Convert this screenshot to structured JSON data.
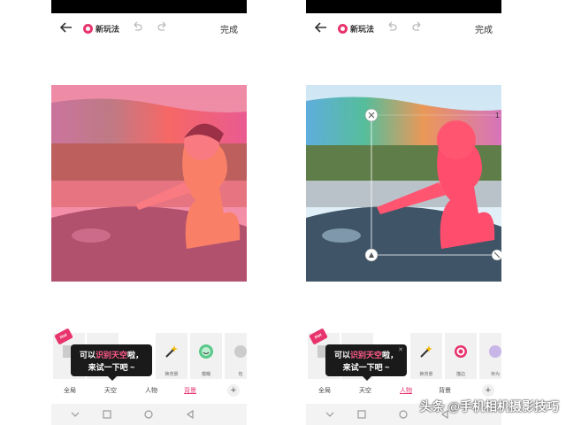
{
  "left": {
    "app_name": "新玩法",
    "done_label": "完成",
    "hot_tag": "Hot",
    "tools": [
      {
        "label": "",
        "icon": "template-icon"
      },
      {
        "label": "",
        "icon": "template-icon"
      },
      {
        "label": "换背景",
        "icon": "wand-icon"
      },
      {
        "label": "模糊",
        "icon": "smile-icon"
      },
      {
        "label": "包",
        "icon": "partial-icon"
      }
    ],
    "tooltip": {
      "line1_a": "可以",
      "line1_hl": "识别天空",
      "line1_b": "啦，",
      "line2": "来试一下吧 ~"
    },
    "categories": [
      "全局",
      "天空",
      "人物",
      "背景"
    ],
    "active_category": "背景",
    "add_label": "+"
  },
  "right": {
    "app_name": "新玩法",
    "done_label": "完成",
    "hot_tag": "Hot",
    "tools": [
      {
        "label": "",
        "icon": "template-icon"
      },
      {
        "label": "",
        "icon": "template-icon"
      },
      {
        "label": "换背景",
        "icon": "wand-icon"
      },
      {
        "label": "描边",
        "icon": "ring-icon"
      },
      {
        "label": "存为",
        "icon": "partial-icon"
      }
    ],
    "tooltip": {
      "line1_a": "可以",
      "line1_hl": "识别天空",
      "line1_b": "啦，",
      "line2": "来试一下吧 ~"
    },
    "categories": [
      "全局",
      "天空",
      "人物",
      "背景"
    ],
    "active_category": "人物",
    "add_label": "+",
    "edge_marker": "1"
  },
  "watermark": "头条 @手机相机摄影技巧",
  "colors": {
    "accent": "#e8336d",
    "mask": "#ff3c64"
  }
}
